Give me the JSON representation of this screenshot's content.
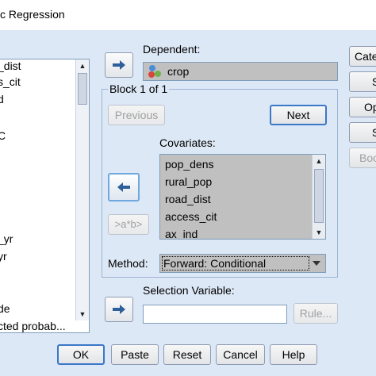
{
  "window": {
    "title": "c Regression"
  },
  "variables": {
    "items": [
      "_dist",
      "s_cit",
      "d",
      "",
      "C",
      "",
      "",
      "",
      "",
      "",
      "_yr",
      "yr",
      "",
      "",
      "de",
      "cted probab..."
    ]
  },
  "dependent": {
    "label": "Dependent:",
    "value": "crop"
  },
  "block": {
    "title": "Block 1 of 1",
    "previous_label": "Previous",
    "next_label": "Next"
  },
  "covariates": {
    "label": "Covariates:",
    "items": [
      "pop_dens",
      "rural_pop",
      "road_dist",
      "access_cit",
      "ax_ind"
    ],
    "interaction_label": ">a*b>"
  },
  "method": {
    "label": "Method:",
    "value": "Forward: Conditional"
  },
  "selection": {
    "label": "Selection Variable:",
    "value": "",
    "rule_label": "Rule..."
  },
  "side_buttons": [
    "Cate",
    "S",
    "Op",
    "S",
    "Boo"
  ],
  "footer": {
    "ok": "OK",
    "paste": "Paste",
    "reset": "Reset",
    "cancel": "Cancel",
    "help": "Help"
  },
  "colors": {
    "dialog_bg": "#dde8f6",
    "selected_bg": "#c0c0c0",
    "focus_border": "#3a78c8"
  },
  "icons": {
    "move_right": "arrow-right-icon",
    "move_left": "arrow-left-icon",
    "variable": "nominal-variable-icon"
  }
}
